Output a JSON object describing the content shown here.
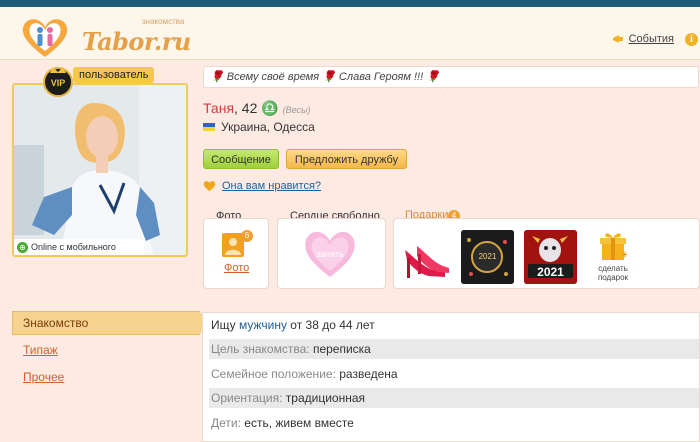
{
  "header": {
    "logo_text": "Tabor.ru",
    "logo_sub": "знакомства",
    "events_label": "События"
  },
  "profile": {
    "role_label": "пользователь",
    "online_label": "Online с мобильного",
    "status_text": "🌹 Всему своё время 🌹 Слава Героям !!! 🌹",
    "name": "Таня",
    "age": ", 42",
    "sign": "♎",
    "sign_label": "(Весы)",
    "location": "Украина, Одесса",
    "buttons": {
      "message": "Сообщение",
      "friend": "Предложить дружбу"
    },
    "like_prompt": "Она вам нравится?"
  },
  "boxes": {
    "photo_title": "Фото",
    "photo_count": "6",
    "photo_link": "Фото",
    "heart_title": "Сердце свободно",
    "heart_action": "занять",
    "gifts_title": "Подарки",
    "gifts_count": "4",
    "gift_2021": "2021",
    "gift_clock": "2021",
    "make_gift": "сделать подарок"
  },
  "nav": {
    "active": "Знакомство",
    "items": [
      "Типаж",
      "Прочее"
    ]
  },
  "details": {
    "seek_prefix": "Ищу ",
    "seek_link": "мужчину",
    "seek_suffix": " от 38 до 44 лет",
    "goal_key": "Цель знакомства:",
    "goal_val": " переписка",
    "family_key": "Семейное положение:",
    "family_val": " разведена",
    "orientation_key": "Ориентация:",
    "orientation_val": " традиционная",
    "kids_key": "Дети:",
    "kids_val": " есть, живем вместе"
  },
  "colors": {
    "accent": "#f0a12d",
    "name": "#d4393f",
    "link": "#1f5f98",
    "nav_link": "#d0612a"
  }
}
